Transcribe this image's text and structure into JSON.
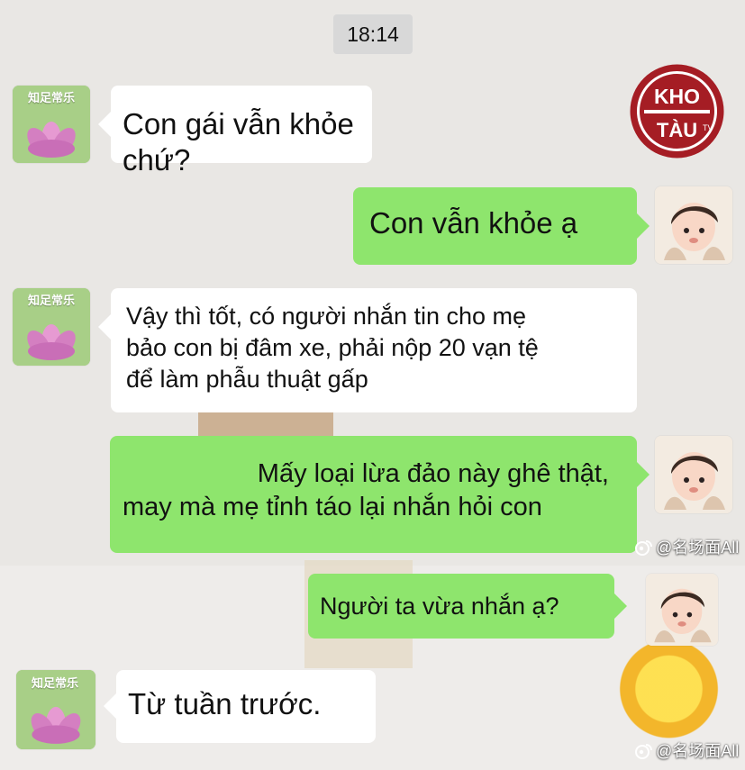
{
  "status": {
    "time": "18:14"
  },
  "colors": {
    "incoming_bubble": "#ffffff",
    "outgoing_bubble": "#8ee56d",
    "background": "#e8e6e3",
    "watermark_text": "#ffffff",
    "logo_red": "#a51d24"
  },
  "avatars": {
    "contact": {
      "label": "知足常乐",
      "icon": "lotus-avatar-icon"
    },
    "user": {
      "icon": "child-avatar-icon"
    }
  },
  "messages": [
    {
      "direction": "incoming",
      "text": "Con gái vẫn khỏe chứ?"
    },
    {
      "direction": "outgoing",
      "text": "Con vẫn khỏe ạ"
    },
    {
      "direction": "incoming",
      "lines": [
        "Vậy thì tốt, có người nhắn tin cho mẹ",
        "bảo con bị đâm xe, phải nộp 20 vạn tệ",
        "để làm phẫu thuật gấp"
      ]
    },
    {
      "direction": "outgoing",
      "lines": [
        "Mấy loại lừa đảo này ghê thật,",
        "may mà mẹ tỉnh táo lại nhắn hỏi con"
      ]
    },
    {
      "direction": "outgoing",
      "text": "Người ta vừa nhắn ạ?"
    },
    {
      "direction": "incoming",
      "text": "Từ tuần trước."
    }
  ],
  "watermarks": [
    {
      "text": "@名场面All"
    },
    {
      "text": "@名场面All"
    }
  ],
  "logo": {
    "top_text": "KHO",
    "bottom_text": "TÀU",
    "suffix": "TV"
  }
}
